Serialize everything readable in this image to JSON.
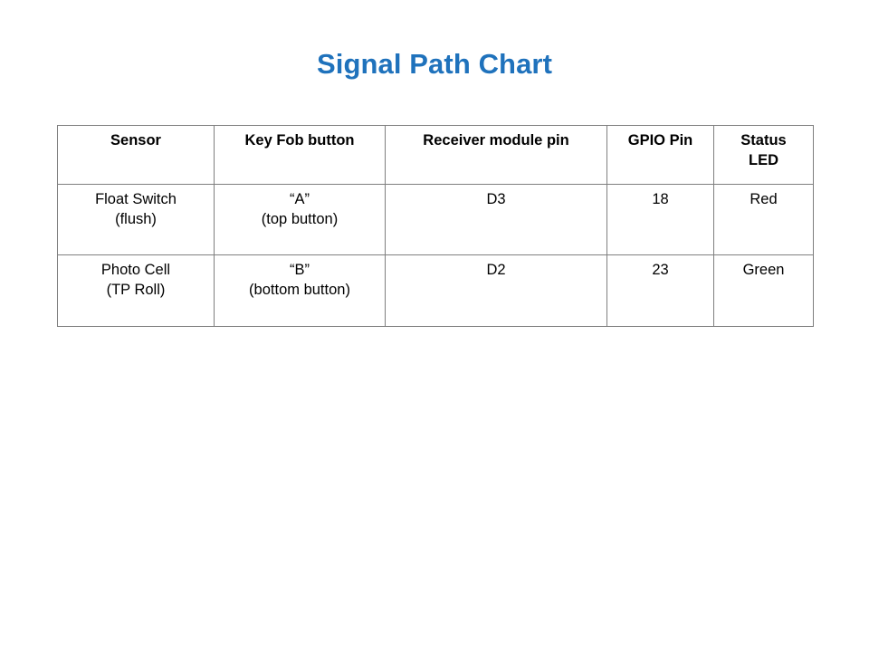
{
  "slide": {
    "title": "Signal Path Chart",
    "title_color": "#1F72BC",
    "background_color": "#FFFFFF",
    "border_color": "#7F7F7F",
    "text_color": "#000000"
  },
  "table": {
    "columns": [
      {
        "key": "sensor",
        "header": "Sensor"
      },
      {
        "key": "keyfob",
        "header": "Key Fob button"
      },
      {
        "key": "receiver",
        "header": "Receiver module pin"
      },
      {
        "key": "gpio",
        "header": "GPIO Pin"
      },
      {
        "key": "status",
        "header_line1": "Status",
        "header_line2": "LED"
      }
    ],
    "rows": [
      {
        "sensor_line1": "Float Switch",
        "sensor_line2": "(flush)",
        "keyfob_line1": "“A”",
        "keyfob_line2": "(top button)",
        "receiver": "D3",
        "gpio": "18",
        "status": "Red"
      },
      {
        "sensor_line1": "Photo Cell",
        "sensor_line2": "(TP Roll)",
        "keyfob_line1": "“B”",
        "keyfob_line2": "(bottom button)",
        "receiver": "D2",
        "gpio": "23",
        "status": "Green"
      }
    ]
  }
}
